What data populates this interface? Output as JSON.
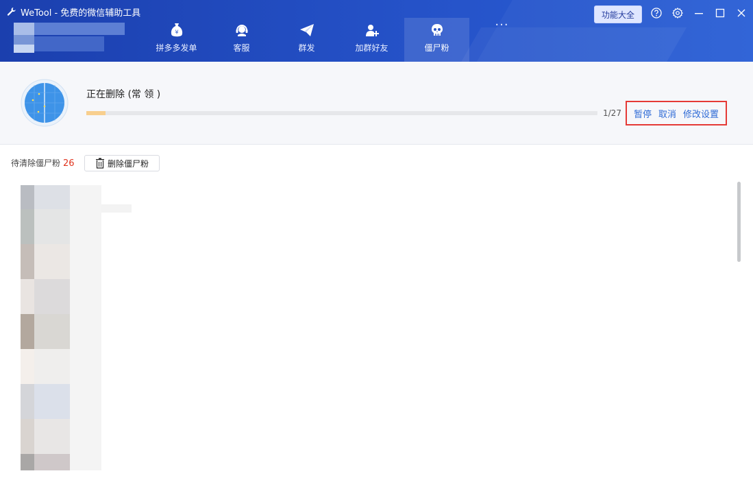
{
  "app": {
    "title": "WeTool - 免费的微信辅助工具"
  },
  "nav": {
    "items": [
      {
        "label": "拼多多发单",
        "icon": "money-bag-icon"
      },
      {
        "label": "客服",
        "icon": "headset-icon"
      },
      {
        "label": "群发",
        "icon": "paper-plane-icon"
      },
      {
        "label": "加群好友",
        "icon": "add-user-icon"
      },
      {
        "label": "僵尸粉",
        "icon": "skull-icon",
        "active": true
      }
    ],
    "more": "···"
  },
  "header": {
    "func_button": "功能大全"
  },
  "status": {
    "text": "正在删除 (常  领    )",
    "progress": {
      "current": 1,
      "total": 27,
      "label": "1/27"
    },
    "actions": {
      "pause": "暂停",
      "cancel": "取消",
      "settings": "修改设置"
    }
  },
  "pending": {
    "label": "待清除僵尸粉",
    "count": "26"
  },
  "delete_button": {
    "label": "删除僵尸粉"
  },
  "colors": {
    "header": "#2552c8",
    "accent": "#2f6bd6",
    "count": "#e0341e",
    "highlight": "#e53935",
    "progress": "#f8cf8e"
  }
}
